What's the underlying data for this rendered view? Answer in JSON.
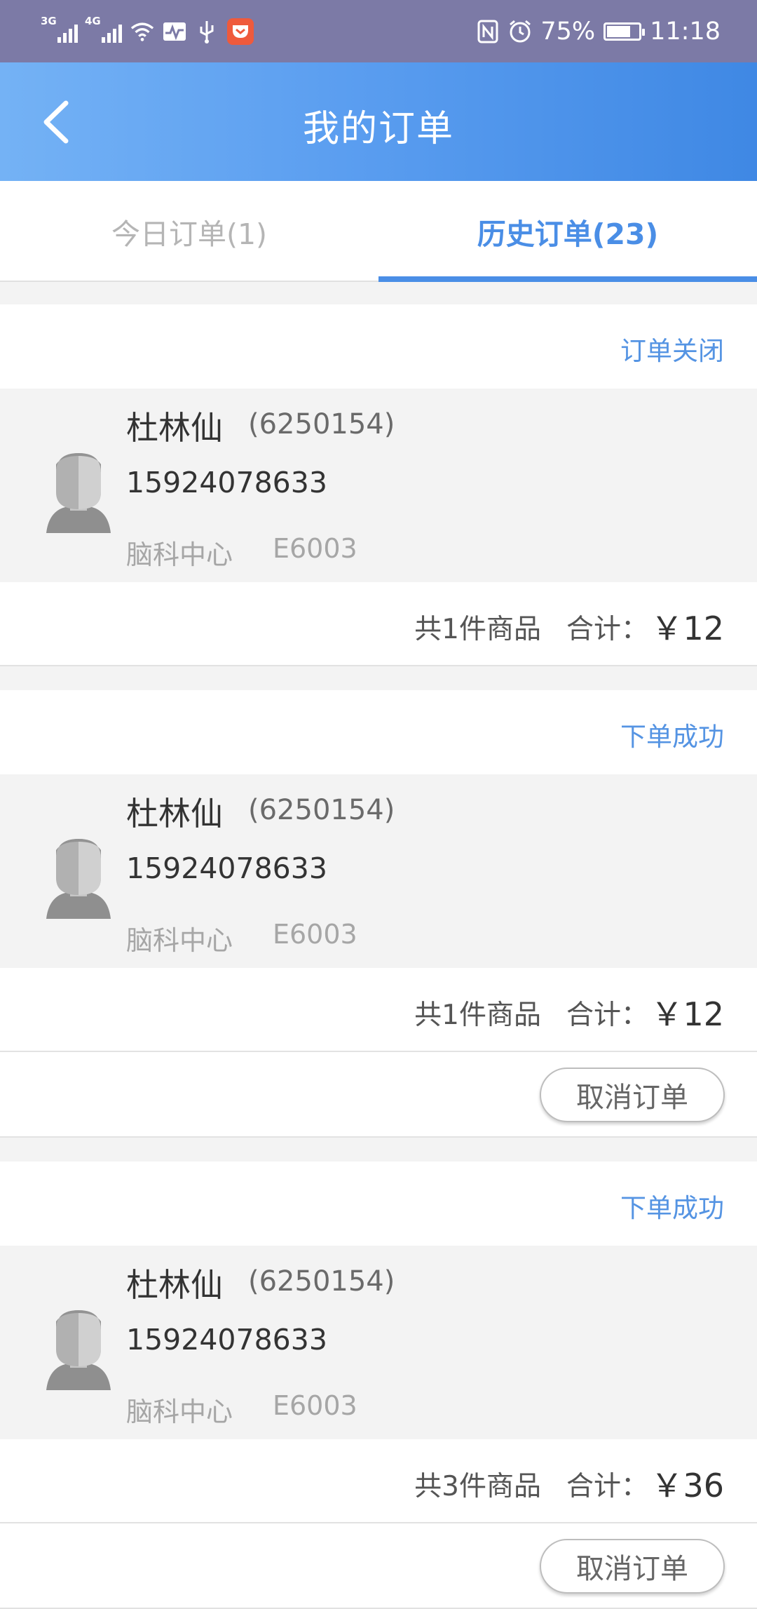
{
  "status_bar": {
    "network_1": "3G",
    "network_2": "4G",
    "battery_percent": "75%",
    "battery_level": 0.75,
    "time": "11:18",
    "icons": [
      "signal-icon",
      "signal-icon",
      "wifi-icon",
      "activity-icon",
      "usb-icon",
      "pocket-app-icon",
      "nfc-icon",
      "alarm-icon",
      "battery-icon"
    ]
  },
  "header": {
    "title": "我的订单",
    "back_icon": "chevron-left-icon"
  },
  "tabs": [
    {
      "label": "今日订单(1)",
      "active": false
    },
    {
      "label": "历史订单(23)",
      "active": true
    }
  ],
  "orders": [
    {
      "status": "订单关闭",
      "name": "杜林仙",
      "patient_id": "(6250154)",
      "phone": "15924078633",
      "department": "脑科中心",
      "bed": "E6003",
      "item_count": "共1件商品",
      "total_label": "合计：",
      "total": "￥12",
      "cancel_label": ""
    },
    {
      "status": "下单成功",
      "name": "杜林仙",
      "patient_id": "(6250154)",
      "phone": "15924078633",
      "department": "脑科中心",
      "bed": "E6003",
      "item_count": "共1件商品",
      "total_label": "合计：",
      "total": "￥12",
      "cancel_label": "取消订单"
    },
    {
      "status": "下单成功",
      "name": "杜林仙",
      "patient_id": "(6250154)",
      "phone": "15924078633",
      "department": "脑科中心",
      "bed": "E6003",
      "item_count": "共3件商品",
      "total_label": "合计：",
      "total": "￥36",
      "cancel_label": "取消订单"
    }
  ],
  "colors": {
    "accent": "#4a8ee6",
    "status_bar": "#7c7aa6",
    "status_text": "#5594e3"
  }
}
